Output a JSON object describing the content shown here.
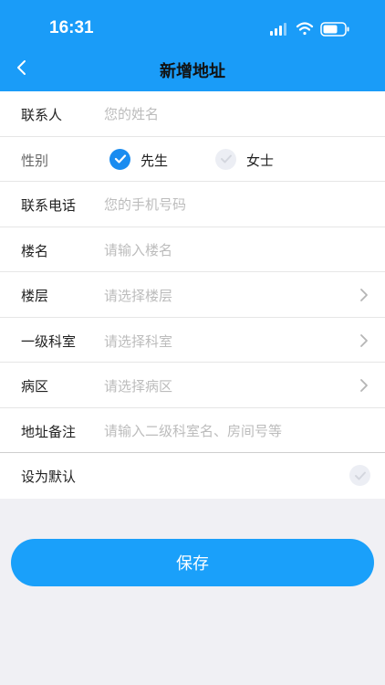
{
  "status_bar": {
    "time": "16:31"
  },
  "nav": {
    "title": "新增地址",
    "back_icon": "chevron-left-icon"
  },
  "form": {
    "contact": {
      "label": "联系人",
      "placeholder": "您的姓名"
    },
    "gender": {
      "label": "性别",
      "options": [
        {
          "label": "先生",
          "selected": true
        },
        {
          "label": "女士",
          "selected": false
        }
      ]
    },
    "phone": {
      "label": "联系电话",
      "placeholder": "您的手机号码"
    },
    "building": {
      "label": "楼名",
      "placeholder": "请输入楼名"
    },
    "floor": {
      "label": "楼层",
      "placeholder": "请选择楼层"
    },
    "department": {
      "label": "一级科室",
      "placeholder": "请选择科室"
    },
    "ward": {
      "label": "病区",
      "placeholder": "请选择病区"
    },
    "note": {
      "label": "地址备注",
      "placeholder": "请输入二级科室名、房间号等"
    },
    "default": {
      "label": "设为默认",
      "checked": false
    }
  },
  "save_button": {
    "label": "保存"
  },
  "colors": {
    "accent": "#1a9cf8",
    "button": "#1aa0fa",
    "background": "#f0f0f4"
  }
}
